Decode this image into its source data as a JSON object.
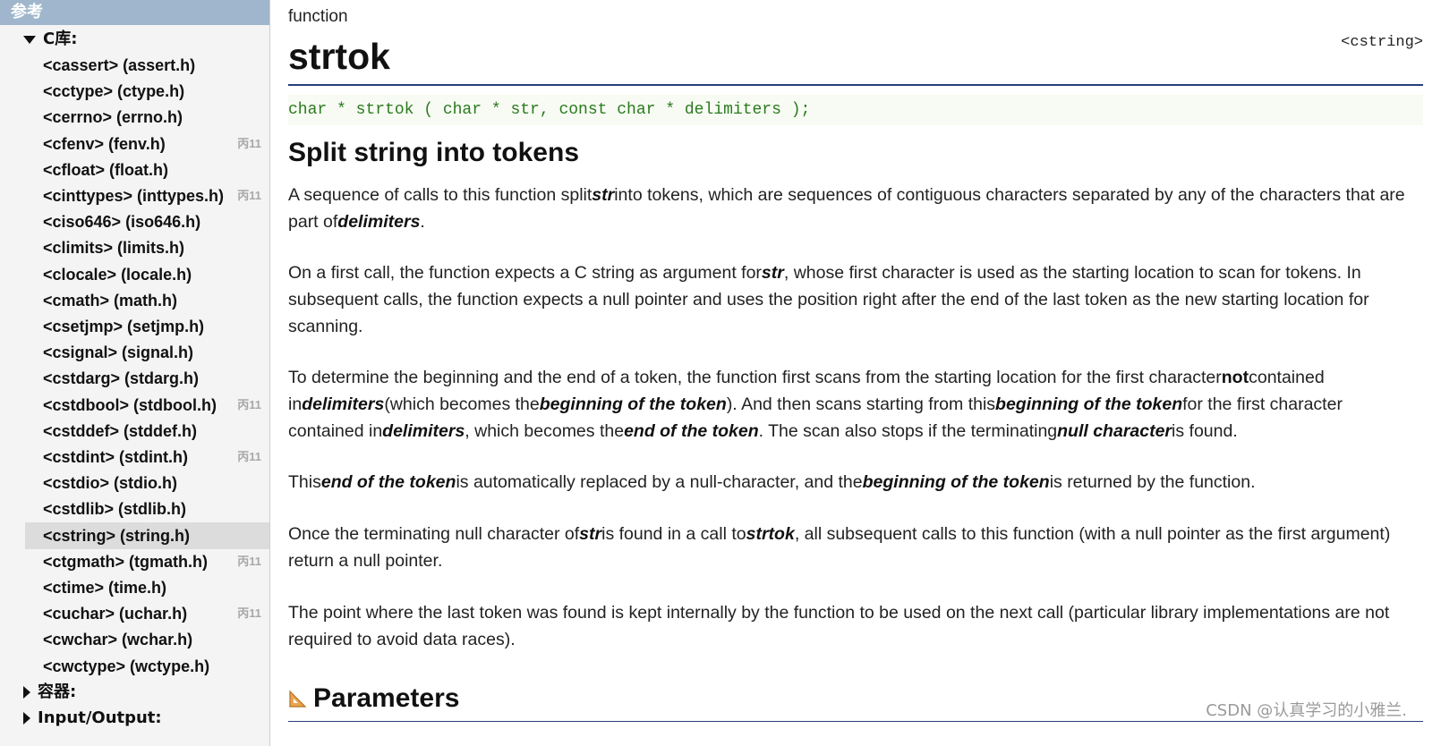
{
  "sidebar": {
    "header": "参考",
    "group_c": "C库:",
    "items": [
      {
        "label": "<cassert> (assert.h)",
        "badge": ""
      },
      {
        "label": "<cctype> (ctype.h)",
        "badge": ""
      },
      {
        "label": "<cerrno> (errno.h)",
        "badge": ""
      },
      {
        "label": "<cfenv> (fenv.h)",
        "badge": "丙11"
      },
      {
        "label": "<cfloat> (float.h)",
        "badge": ""
      },
      {
        "label": "<cinttypes> (inttypes.h)",
        "badge": "丙11"
      },
      {
        "label": "<ciso646> (iso646.h)",
        "badge": ""
      },
      {
        "label": "<climits> (limits.h)",
        "badge": ""
      },
      {
        "label": "<clocale> (locale.h)",
        "badge": ""
      },
      {
        "label": "<cmath> (math.h)",
        "badge": ""
      },
      {
        "label": "<csetjmp> (setjmp.h)",
        "badge": ""
      },
      {
        "label": "<csignal> (signal.h)",
        "badge": ""
      },
      {
        "label": "<cstdarg> (stdarg.h)",
        "badge": ""
      },
      {
        "label": "<cstdbool> (stdbool.h)",
        "badge": "丙11"
      },
      {
        "label": "<cstddef> (stddef.h)",
        "badge": ""
      },
      {
        "label": "<cstdint> (stdint.h)",
        "badge": "丙11"
      },
      {
        "label": "<cstdio> (stdio.h)",
        "badge": ""
      },
      {
        "label": "<cstdlib> (stdlib.h)",
        "badge": ""
      },
      {
        "label": "<cstring> (string.h)",
        "badge": "",
        "active": true
      },
      {
        "label": "<ctgmath> (tgmath.h)",
        "badge": "丙11"
      },
      {
        "label": "<ctime> (time.h)",
        "badge": ""
      },
      {
        "label": "<cuchar> (uchar.h)",
        "badge": "丙11"
      },
      {
        "label": "<cwchar> (wchar.h)",
        "badge": ""
      },
      {
        "label": "<cwctype> (wctype.h)",
        "badge": ""
      }
    ],
    "group_containers": "容器:",
    "group_io": "Input/Output:"
  },
  "page": {
    "kind": "function",
    "title": "strtok",
    "header_lib": "<cstring>",
    "prototype": "char * strtok ( char * str, const char * delimiters );",
    "section_title": "Split string into tokens",
    "p1": {
      "a": "A sequence of calls to this function split",
      "b": "str",
      "c": "into tokens, which are sequences of contiguous characters separated by any of the characters that are part of",
      "d": "delimiters",
      "e": "."
    },
    "p2": {
      "a": "On a first call, the function expects a C string as argument for",
      "b": "str",
      "c": ", whose first character is used as the starting location to scan for tokens. In subsequent calls, the function expects a null pointer and uses the position right after the end of the last token as the new starting location for scanning."
    },
    "p3": {
      "a": "To determine the beginning and the end of a token, the function first scans from the starting location for the first character",
      "b": "not",
      "c": "contained in",
      "d": "delimiters",
      "e": "(which becomes the",
      "f": "beginning of the token",
      "g": "). And then scans starting from this",
      "h": "beginning of the token",
      "i": "for the first character contained in",
      "j": "delimiters",
      "k": ", which becomes the",
      "l": "end of the token",
      "m": ". The scan also stops if the terminating",
      "n": "null character",
      "o": "is found."
    },
    "p4": {
      "a": "This",
      "b": "end of the token",
      "c": "is automatically replaced by a null-character, and the",
      "d": "beginning of the token",
      "e": "is returned by the function."
    },
    "p5": {
      "a": "Once the terminating null character of",
      "b": "str",
      "c": "is found in a call to",
      "d": "strtok",
      "e": ", all subsequent calls to this function (with a null pointer as the first argument) return a null pointer."
    },
    "p6": "The point where the last token was found is kept internally by the function to be used on the next call (particular library implementations are not required to avoid data races).",
    "parameters_heading": "Parameters",
    "parameters_icon": "ruler-triangle-icon",
    "watermark": "CSDN @认真学习的小雅兰."
  },
  "colors": {
    "sidebar_header_bg": "#9fb6cc",
    "title_rule": "#2a3f7a",
    "prototype_text": "#2b7a1f",
    "badge": "#a8a8a8"
  }
}
